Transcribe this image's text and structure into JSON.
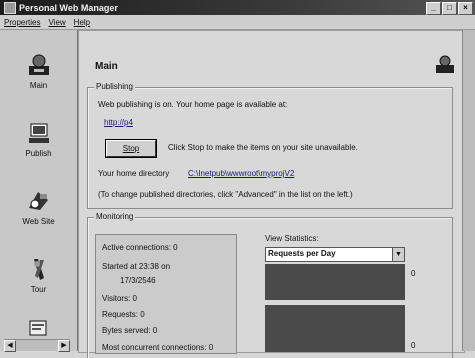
{
  "window": {
    "title": "Personal Web Manager",
    "controls": [
      "_",
      "□",
      "×"
    ]
  },
  "menu": [
    "Properties",
    "View",
    "Help"
  ],
  "sidebar": {
    "items": [
      {
        "label": "Main",
        "icon": "main-icon"
      },
      {
        "label": "Publish",
        "icon": "publish-icon"
      },
      {
        "label": "Web Site",
        "icon": "web-site-icon"
      },
      {
        "label": "Tour",
        "icon": "tour-icon"
      },
      {
        "label": "",
        "icon": "advanced-icon"
      }
    ]
  },
  "main": {
    "title": "Main",
    "publishing": {
      "legend": "Publishing",
      "status_text": "Web publishing is on. Your home page is available at:",
      "home_url": "http://p4",
      "stop_label": "Stop",
      "stop_hint": "Click Stop to make the items on your site unavailable.",
      "home_dir_label": "Your home directory",
      "home_dir_value": "C:\\Inetpub\\wwwroot\\myprojV2",
      "note": "(To change published directories, click \"Advanced\" in the list on the left.)"
    },
    "monitoring": {
      "legend": "Monitoring",
      "active_connections": "Active connections: 0",
      "started_at": "Started at 23:38 on",
      "started_date": "17/3/2546",
      "visitors": "Visitors: 0",
      "requests": "Requests: 0",
      "bytes_served": "Bytes served: 0",
      "most_concurrent": "Most concurrent connections: 0",
      "view_statistics_label": "View Statistics:",
      "selected_stat": "Requests per Day",
      "chart_top_value": "0",
      "chart_bottom_value": "0"
    }
  }
}
